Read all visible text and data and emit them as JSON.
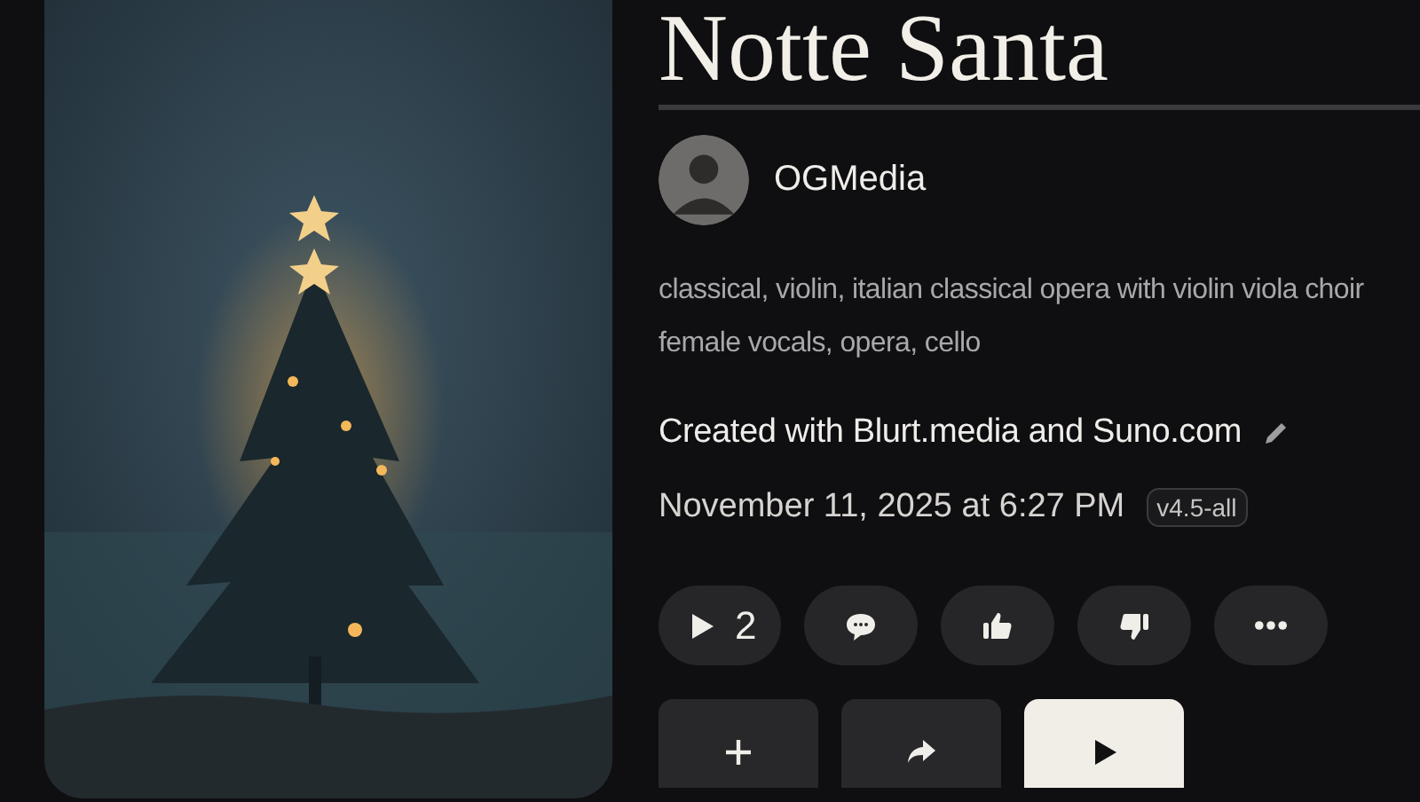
{
  "title": "Notte Santa",
  "artist": {
    "name": "OGMedia"
  },
  "tags": "classical, violin, italian classical opera with violin viola choir female vocals, opera, cello",
  "description": "Created with Blurt.media and Suno.com",
  "date": "November 11, 2025 at 6:27 PM",
  "model_badge": "v4.5-all",
  "actions": [
    {
      "kind": "play",
      "count": "2"
    },
    {
      "kind": "comment"
    },
    {
      "kind": "like"
    },
    {
      "kind": "dislike"
    },
    {
      "kind": "more"
    }
  ],
  "buttons": [
    {
      "kind": "add",
      "primary": false
    },
    {
      "kind": "share",
      "primary": false
    },
    {
      "kind": "play",
      "primary": true
    }
  ]
}
